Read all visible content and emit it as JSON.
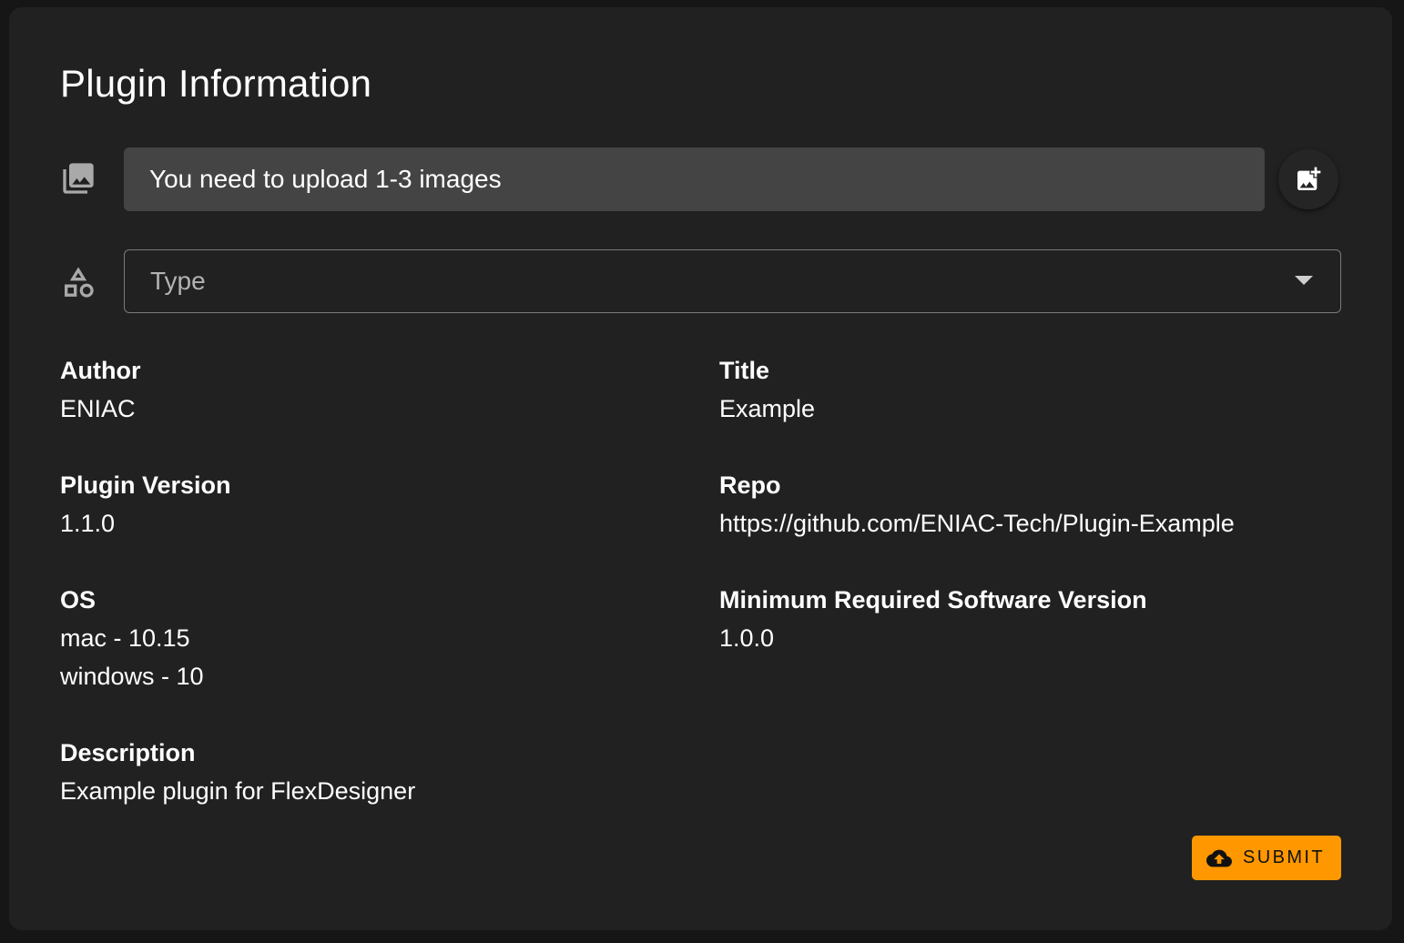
{
  "header": {
    "title": "Plugin Information"
  },
  "images": {
    "icon": "photo-library-icon",
    "message": "You need to upload 1-3 images",
    "add_button_icon": "add-photo-icon"
  },
  "type_select": {
    "icon": "category-shapes-icon",
    "placeholder": "Type",
    "dropdown_icon": "arrow-drop-down-icon"
  },
  "fields": {
    "author": {
      "label": "Author",
      "value": "ENIAC"
    },
    "title": {
      "label": "Title",
      "value": "Example"
    },
    "plugin_version": {
      "label": "Plugin Version",
      "value": "1.1.0"
    },
    "repo": {
      "label": "Repo",
      "value": "https://github.com/ENIAC-Tech/Plugin-Example"
    },
    "os": {
      "label": "OS",
      "values": [
        "mac - 10.15",
        "windows - 10"
      ]
    },
    "min_software_version": {
      "label": "Minimum Required Software Version",
      "value": "1.0.0"
    },
    "description": {
      "label": "Description",
      "value": "Example plugin for FlexDesigner"
    }
  },
  "submit": {
    "label": "SUBMIT",
    "icon": "cloud-upload-icon"
  },
  "colors": {
    "background": "#161616",
    "card": "#212121",
    "image_field": "#444444",
    "accent": "#ff9800",
    "icon_gray": "#a9a9a9"
  }
}
